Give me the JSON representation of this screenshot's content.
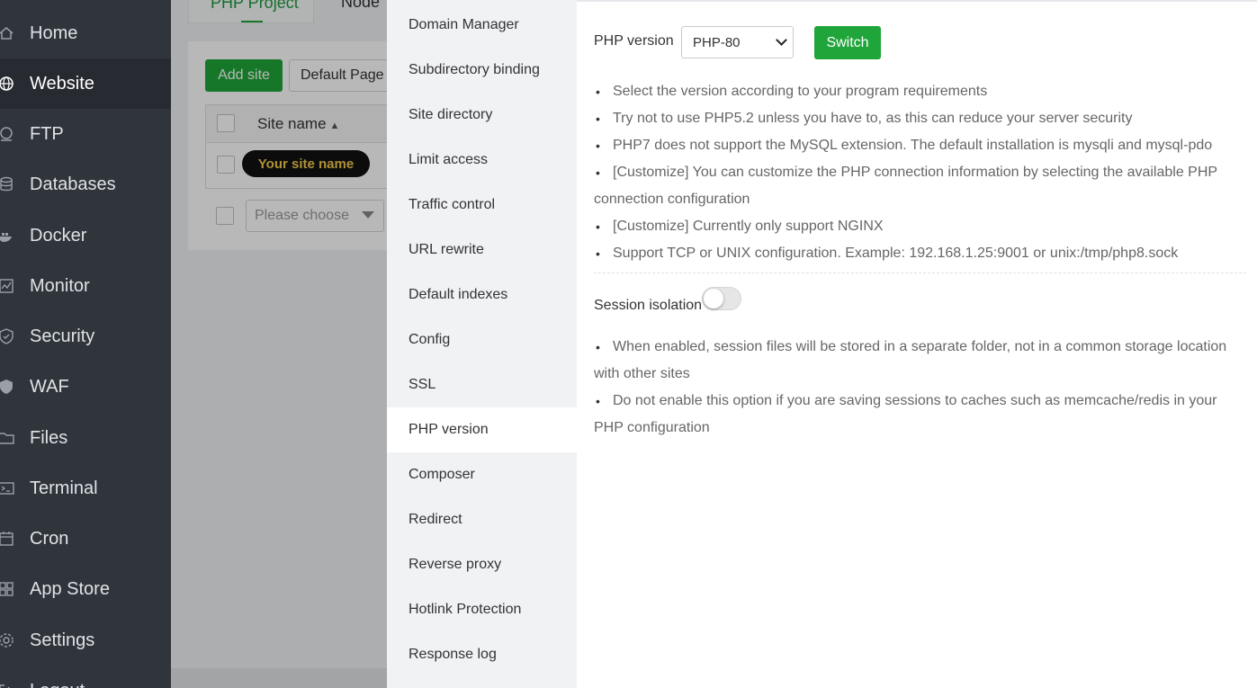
{
  "sidebar": {
    "items": [
      {
        "label": "Home",
        "icon": "home-icon",
        "active": false
      },
      {
        "label": "Website",
        "icon": "globe-icon",
        "active": true
      },
      {
        "label": "FTP",
        "icon": "ftp-icon",
        "active": false
      },
      {
        "label": "Databases",
        "icon": "database-icon",
        "active": false
      },
      {
        "label": "Docker",
        "icon": "docker-icon",
        "active": false
      },
      {
        "label": "Monitor",
        "icon": "monitor-icon",
        "active": false
      },
      {
        "label": "Security",
        "icon": "shield-icon",
        "active": false
      },
      {
        "label": "WAF",
        "icon": "waf-shield-icon",
        "active": false
      },
      {
        "label": "Files",
        "icon": "folder-icon",
        "active": false
      },
      {
        "label": "Terminal",
        "icon": "terminal-icon",
        "active": false
      },
      {
        "label": "Cron",
        "icon": "calendar-icon",
        "active": false
      },
      {
        "label": "App Store",
        "icon": "grid-icon",
        "active": false
      },
      {
        "label": "Settings",
        "icon": "gear-icon",
        "active": false
      },
      {
        "label": "Logout",
        "icon": "logout-icon",
        "active": false
      }
    ]
  },
  "background_page": {
    "tab_active": "PHP Project",
    "tab_next": "Node",
    "add_site_label": "Add site",
    "default_page_label": "Default Page",
    "column_site_name": "Site name",
    "site_name_value": "Your site name",
    "bulk_select_placeholder": "Please choose"
  },
  "panel_menu": {
    "items": [
      {
        "label": "Domain Manager",
        "active": false
      },
      {
        "label": "Subdirectory binding",
        "active": false
      },
      {
        "label": "Site directory",
        "active": false
      },
      {
        "label": "Limit access",
        "active": false
      },
      {
        "label": "Traffic control",
        "active": false
      },
      {
        "label": "URL rewrite",
        "active": false
      },
      {
        "label": "Default indexes",
        "active": false
      },
      {
        "label": "Config",
        "active": false
      },
      {
        "label": "SSL",
        "active": false
      },
      {
        "label": "PHP version",
        "active": true
      },
      {
        "label": "Composer",
        "active": false
      },
      {
        "label": "Redirect",
        "active": false
      },
      {
        "label": "Reverse proxy",
        "active": false
      },
      {
        "label": "Hotlink Protection",
        "active": false
      },
      {
        "label": "Response log",
        "active": false
      }
    ]
  },
  "php_version": {
    "label": "PHP version",
    "selected": "PHP-80",
    "switch_label": "Switch",
    "tips": [
      "Select the version according to your program requirements",
      "Try not to use PHP5.2 unless you have to, as this can reduce your server security",
      "PHP7 does not support the MySQL extension. The default installation is mysqli and mysql-pdo",
      "[Customize] You can customize the PHP connection information by selecting the available PHP connection configuration",
      "[Customize] Currently only support NGINX",
      "Support TCP or UNIX configuration. Example: 192.168.1.25:9001 or unix:/tmp/php8.sock"
    ]
  },
  "session_isolation": {
    "label": "Session isolation",
    "enabled": false,
    "tips": [
      "When enabled, session files will be stored in a separate folder, not in a common storage location with other sites",
      "Do not enable this option if you are saving sessions to caches such as memcache/redis in your PHP configuration"
    ]
  },
  "colors": {
    "accent_green": "#20a53a",
    "sidebar_bg": "#30353c",
    "sidebar_active_bg": "#272b31",
    "menu_bg": "#f1f2f4"
  }
}
